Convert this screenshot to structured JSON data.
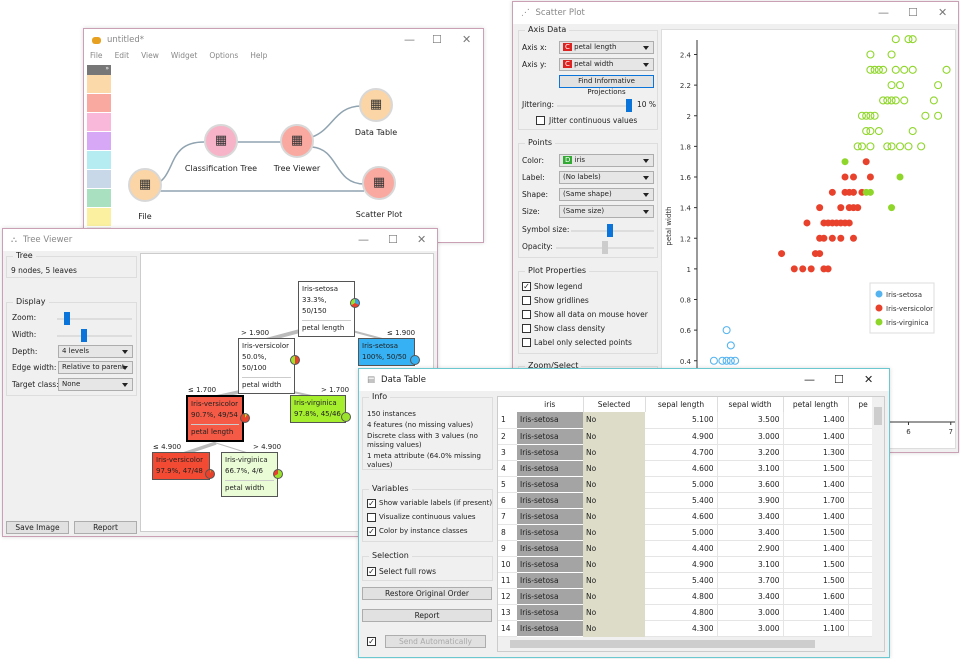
{
  "canvas": {
    "title": "untitled*",
    "menu": [
      "File",
      "Edit",
      "View",
      "Widget",
      "Options",
      "Help"
    ],
    "toolbox_colors": [
      "#fcd9a8",
      "#f9a9a0",
      "#f9b7da",
      "#d6a8f5",
      "#b5ecf2",
      "#c8d8e8",
      "#a8e0c0",
      "#faf0a0"
    ],
    "nodes": [
      {
        "label": "File",
        "icon": "file-icon",
        "color": "#fbd5a5"
      },
      {
        "label": "Classification Tree",
        "icon": "tree-icon",
        "color": "#f7b3c7"
      },
      {
        "label": "Tree Viewer",
        "icon": "tree-viewer-icon",
        "color": "#f9a9a0"
      },
      {
        "label": "Data Table",
        "icon": "table-icon",
        "color": "#fbd5a5"
      },
      {
        "label": "Scatter Plot",
        "icon": "scatter-icon",
        "color": "#f9a9a0"
      }
    ]
  },
  "tree_viewer": {
    "title": "Tree Viewer",
    "tree_box": "Tree",
    "tree_info": "9 nodes, 5 leaves",
    "display_box": "Display",
    "zoom_label": "Zoom:",
    "zoom_value": 0.1,
    "width_label": "Width:",
    "width_value": 0.35,
    "depth_label": "Depth:",
    "depth_value": "4 levels",
    "edge_label": "Edge width:",
    "edge_value": "Relative to parent",
    "target_label": "Target class:",
    "target_value": "None",
    "save_image": "Save Image",
    "report": "Report",
    "nodes": [
      {
        "cls": "Iris-setosa",
        "stats": "33.3%, 50/150",
        "split": "petal length",
        "color": "#ffffff",
        "pie": "conic-gradient(#3ca0f0 0 33%,#e8412c 33% 66%,#9be22d 66%)"
      },
      {
        "cls": "Iris-versicolor",
        "stats": "50.0%, 50/100",
        "split": "petal width",
        "color": "#ffffff",
        "pie": "conic-gradient(#e8412c 0 50%,#9be22d 50%)"
      },
      {
        "cls": "Iris-setosa",
        "stats": "100%, 50/50",
        "split": "",
        "color": "#36b1f4",
        "pie": "#36b1f4"
      },
      {
        "cls": "Iris-versicolor",
        "stats": "90.7%, 49/54",
        "split": "petal length",
        "color": "#f45a45",
        "pie": "conic-gradient(#9be22d 0 9%,#e8412c 9%)"
      },
      {
        "cls": "Iris-virginica",
        "stats": "97.8%, 45/46",
        "split": "",
        "color": "#a5ee2e",
        "pie": "#9be22d"
      },
      {
        "cls": "Iris-versicolor",
        "stats": "97.9%, 47/48",
        "split": "",
        "color": "#f24a33",
        "pie": "conic-gradient(#9be22d 0 3%,#e8412c 3%)"
      },
      {
        "cls": "Iris-virginica",
        "stats": "66.7%, 4/6",
        "split": "petal width",
        "color": "#eafcd6",
        "pie": "conic-gradient(#9be22d 0 67%,#e8412c 67%)"
      }
    ],
    "edges": [
      "> 1.900",
      "≤ 1.900",
      "≤ 1.700",
      "> 1.700",
      "≤ 4.900",
      "> 4.900"
    ]
  },
  "scatter": {
    "title": "Scatter Plot",
    "axis_data": "Axis Data",
    "axis_x_label": "Axis x:",
    "axis_x": "petal length",
    "axis_y_label": "Axis y:",
    "axis_y": "petal width",
    "find_button": "Find Informative Projections",
    "jitter_label": "Jittering:",
    "jitter_value": "10 %",
    "jitter_fraction": 1.0,
    "jitter_cont": "Jitter continuous values",
    "points_box": "Points",
    "color_label": "Color:",
    "color_value": "iris",
    "label_label": "Label:",
    "label_value": "(No labels)",
    "shape_label": "Shape:",
    "shape_value": "(Same shape)",
    "size_label": "Size:",
    "size_value": "(Same size)",
    "symbol_label": "Symbol size:",
    "opacity_label": "Opacity:",
    "plot_props": "Plot Properties",
    "checks": [
      {
        "label": "Show legend",
        "checked": true
      },
      {
        "label": "Show gridlines",
        "checked": false
      },
      {
        "label": "Show all data on mouse hover",
        "checked": false
      },
      {
        "label": "Show class density",
        "checked": false
      },
      {
        "label": "Label only selected points",
        "checked": false
      }
    ],
    "zoom_select": "Zoom/Select"
  },
  "chart_data": {
    "type": "scatter",
    "ylabel": "petal width",
    "xlabel": "",
    "xlim": [
      1,
      7.1
    ],
    "ylim": [
      0,
      2.56
    ],
    "xticks": [
      6,
      7
    ],
    "yticks": [
      0.4,
      0.6,
      0.8,
      1,
      1.2,
      1.4,
      1.6,
      1.8,
      2,
      2.2,
      2.4
    ],
    "grid": false,
    "legend": "bottom-right",
    "series": [
      {
        "name": "Iris-setosa",
        "color": "#55b4f0",
        "points": [
          [
            1.4,
            0.4,
            0
          ],
          [
            1.6,
            0.4,
            0
          ],
          [
            1.7,
            0.4,
            0
          ],
          [
            1.8,
            0.4,
            0
          ],
          [
            1.9,
            0.4,
            0
          ],
          [
            1.8,
            0.5,
            0
          ],
          [
            1.7,
            0.6,
            0
          ]
        ]
      },
      {
        "name": "Iris-versicolor",
        "color": "#e8412c",
        "points": [
          [
            5.0,
            1.7,
            1
          ],
          [
            4.5,
            1.6,
            1
          ],
          [
            4.7,
            1.6,
            1
          ],
          [
            5.1,
            1.6,
            1
          ],
          [
            4.2,
            1.5,
            1
          ],
          [
            4.5,
            1.5,
            1
          ],
          [
            4.6,
            1.5,
            1
          ],
          [
            4.7,
            1.5,
            1
          ],
          [
            4.9,
            1.5,
            1
          ],
          [
            3.9,
            1.4,
            1
          ],
          [
            4.4,
            1.4,
            1
          ],
          [
            4.6,
            1.4,
            1
          ],
          [
            4.7,
            1.4,
            1
          ],
          [
            4.8,
            1.4,
            1
          ],
          [
            3.6,
            1.3,
            1
          ],
          [
            4.0,
            1.3,
            1
          ],
          [
            4.1,
            1.3,
            1
          ],
          [
            4.2,
            1.3,
            1
          ],
          [
            4.3,
            1.3,
            1
          ],
          [
            4.4,
            1.3,
            1
          ],
          [
            4.5,
            1.3,
            1
          ],
          [
            4.6,
            1.3,
            1
          ],
          [
            3.9,
            1.2,
            1
          ],
          [
            4.0,
            1.2,
            1
          ],
          [
            4.2,
            1.2,
            1
          ],
          [
            4.4,
            1.2,
            1
          ],
          [
            4.7,
            1.2,
            1
          ],
          [
            3.0,
            1.1,
            1
          ],
          [
            3.8,
            1.1,
            1
          ],
          [
            3.9,
            1.1,
            1
          ],
          [
            3.3,
            1.0,
            1
          ],
          [
            3.5,
            1.0,
            1
          ],
          [
            3.7,
            1.0,
            1
          ],
          [
            4.0,
            1.0,
            1
          ],
          [
            4.1,
            1.0,
            1
          ]
        ]
      },
      {
        "name": "Iris-virginica",
        "color": "#8fd62a",
        "points": [
          [
            5.7,
            2.5,
            0
          ],
          [
            6.0,
            2.5,
            0
          ],
          [
            6.1,
            2.5,
            0
          ],
          [
            5.1,
            2.4,
            0
          ],
          [
            5.6,
            2.4,
            0
          ],
          [
            5.1,
            2.3,
            0
          ],
          [
            5.2,
            2.3,
            0
          ],
          [
            5.3,
            2.3,
            0
          ],
          [
            5.4,
            2.3,
            0
          ],
          [
            5.7,
            2.3,
            0
          ],
          [
            5.9,
            2.3,
            0
          ],
          [
            6.1,
            2.3,
            0
          ],
          [
            6.9,
            2.3,
            0
          ],
          [
            5.6,
            2.2,
            0
          ],
          [
            5.8,
            2.2,
            0
          ],
          [
            6.7,
            2.2,
            0
          ],
          [
            5.4,
            2.1,
            0
          ],
          [
            5.5,
            2.1,
            0
          ],
          [
            5.6,
            2.1,
            0
          ],
          [
            5.7,
            2.1,
            0
          ],
          [
            5.9,
            2.1,
            0
          ],
          [
            6.6,
            2.1,
            0
          ],
          [
            4.9,
            2.0,
            0
          ],
          [
            5.0,
            2.0,
            0
          ],
          [
            5.1,
            2.0,
            0
          ],
          [
            5.2,
            2.0,
            0
          ],
          [
            6.4,
            2.0,
            0
          ],
          [
            6.7,
            2.0,
            0
          ],
          [
            5.0,
            1.9,
            0
          ],
          [
            5.1,
            1.9,
            0
          ],
          [
            5.3,
            1.9,
            0
          ],
          [
            6.1,
            1.9,
            0
          ],
          [
            4.8,
            1.8,
            0
          ],
          [
            4.9,
            1.8,
            0
          ],
          [
            5.1,
            1.8,
            0
          ],
          [
            5.5,
            1.8,
            0
          ],
          [
            5.6,
            1.8,
            0
          ],
          [
            5.8,
            1.8,
            0
          ],
          [
            6.0,
            1.8,
            0
          ],
          [
            6.3,
            1.8,
            0
          ],
          [
            4.5,
            1.7,
            1
          ],
          [
            5.8,
            1.6,
            1
          ],
          [
            5.0,
            1.5,
            1
          ],
          [
            5.1,
            1.5,
            1
          ],
          [
            5.6,
            1.4,
            1
          ]
        ]
      }
    ]
  },
  "data_table": {
    "title": "Data Table",
    "info_box": "Info",
    "info": [
      "150 instances",
      "4 features (no missing values)",
      "Discrete class with 3 values (no missing values)",
      "1 meta attribute (64.0% missing values)"
    ],
    "variables_box": "Variables",
    "variables": [
      {
        "label": "Show variable labels (if present)",
        "checked": true
      },
      {
        "label": "Visualize continuous values",
        "checked": false
      },
      {
        "label": "Color by instance classes",
        "checked": true
      }
    ],
    "selection_box": "Selection",
    "select_full_rows": "Select full rows",
    "restore": "Restore Original Order",
    "report": "Report",
    "send_auto": "Send Automatically",
    "columns": [
      "iris",
      "Selected",
      "sepal length",
      "sepal width",
      "petal length",
      "pe"
    ],
    "rows": [
      [
        "1",
        "Iris-setosa",
        "No",
        "5.100",
        "3.500",
        "1.400"
      ],
      [
        "2",
        "Iris-setosa",
        "No",
        "4.900",
        "3.000",
        "1.400"
      ],
      [
        "3",
        "Iris-setosa",
        "No",
        "4.700",
        "3.200",
        "1.300"
      ],
      [
        "4",
        "Iris-setosa",
        "No",
        "4.600",
        "3.100",
        "1.500"
      ],
      [
        "5",
        "Iris-setosa",
        "No",
        "5.000",
        "3.600",
        "1.400"
      ],
      [
        "6",
        "Iris-setosa",
        "No",
        "5.400",
        "3.900",
        "1.700"
      ],
      [
        "7",
        "Iris-setosa",
        "No",
        "4.600",
        "3.400",
        "1.400"
      ],
      [
        "8",
        "Iris-setosa",
        "No",
        "5.000",
        "3.400",
        "1.500"
      ],
      [
        "9",
        "Iris-setosa",
        "No",
        "4.400",
        "2.900",
        "1.400"
      ],
      [
        "10",
        "Iris-setosa",
        "No",
        "4.900",
        "3.100",
        "1.500"
      ],
      [
        "11",
        "Iris-setosa",
        "No",
        "5.400",
        "3.700",
        "1.500"
      ],
      [
        "12",
        "Iris-setosa",
        "No",
        "4.800",
        "3.400",
        "1.600"
      ],
      [
        "13",
        "Iris-setosa",
        "No",
        "4.800",
        "3.000",
        "1.400"
      ],
      [
        "14",
        "Iris-setosa",
        "No",
        "4.300",
        "3.000",
        "1.100"
      ]
    ]
  }
}
